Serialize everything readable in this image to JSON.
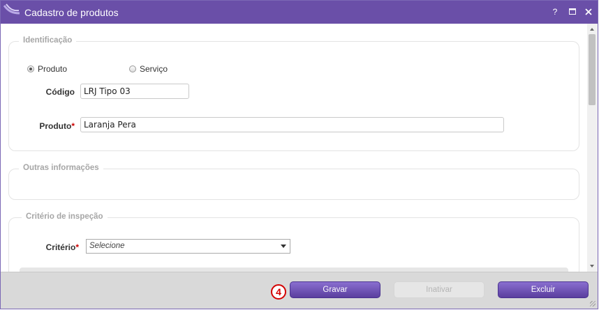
{
  "window": {
    "title": "Cadastro de produtos",
    "help_label": "?",
    "accent": "#6a4fa8"
  },
  "identificacao": {
    "legend": "Identificação",
    "radio_produto": "Produto",
    "radio_servico": "Serviço",
    "selected": "Produto",
    "codigo_label": "Código",
    "codigo_value": "LRJ Tipo 03",
    "produto_label": "Produto",
    "produto_value": "Laranja Pera",
    "required_mark": "*"
  },
  "outras": {
    "legend": "Outras informações"
  },
  "criterio": {
    "legend": "Critério de inspeção",
    "label": "Critério",
    "required_mark": "*",
    "selected_value": "Selecione"
  },
  "footer": {
    "step_number": "4",
    "gravar_label": "Gravar",
    "inativar_label": "Inativar",
    "excluir_label": "Excluir"
  }
}
